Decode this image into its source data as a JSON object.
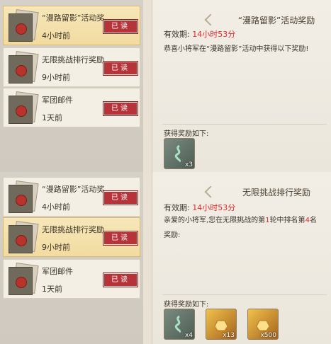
{
  "panel_a": {
    "mails": [
      {
        "title": "“漫路留影”活动奖",
        "time": "4小时前",
        "button": "已读"
      },
      {
        "title": "无限挑战排行奖励",
        "time": "9小时前",
        "button": "已读"
      },
      {
        "title": "军团邮件",
        "time": "1天前",
        "button": "已读"
      }
    ],
    "detail": {
      "title": "“漫路留影”活动奖励",
      "validity_label": "有效期:",
      "validity_value": "14小时53分",
      "body": "恭喜小将军在“漫路留影”活动中获得以下奖励!",
      "reward_label": "获得奖励如下:",
      "rewards": [
        {
          "icon": "jade-token-icon",
          "count": "x3"
        }
      ]
    }
  },
  "panel_b": {
    "mails": [
      {
        "title": "“漫路留影”活动奖",
        "time": "4小时前",
        "button": "已读"
      },
      {
        "title": "无限挑战排行奖励",
        "time": "9小时前",
        "button": "已读"
      },
      {
        "title": "军团邮件",
        "time": "1天前",
        "button": "已读"
      }
    ],
    "detail": {
      "title": "无限挑战排行奖励",
      "validity_label": "有效期:",
      "validity_value": "14小时53分",
      "body_prefix": "亲爱的小将军,您在无限挑战的第",
      "round": "1",
      "body_mid": "轮中排名第",
      "rank": "4",
      "body_suffix": "名",
      "body_line2": "奖励:",
      "reward_label": "获得奖励如下:",
      "rewards": [
        {
          "icon": "jade-token-icon",
          "count": "x4"
        },
        {
          "icon": "gold-ingot-icon",
          "count": "x13"
        },
        {
          "icon": "gold-ingot-icon",
          "count": "x500"
        }
      ]
    }
  }
}
